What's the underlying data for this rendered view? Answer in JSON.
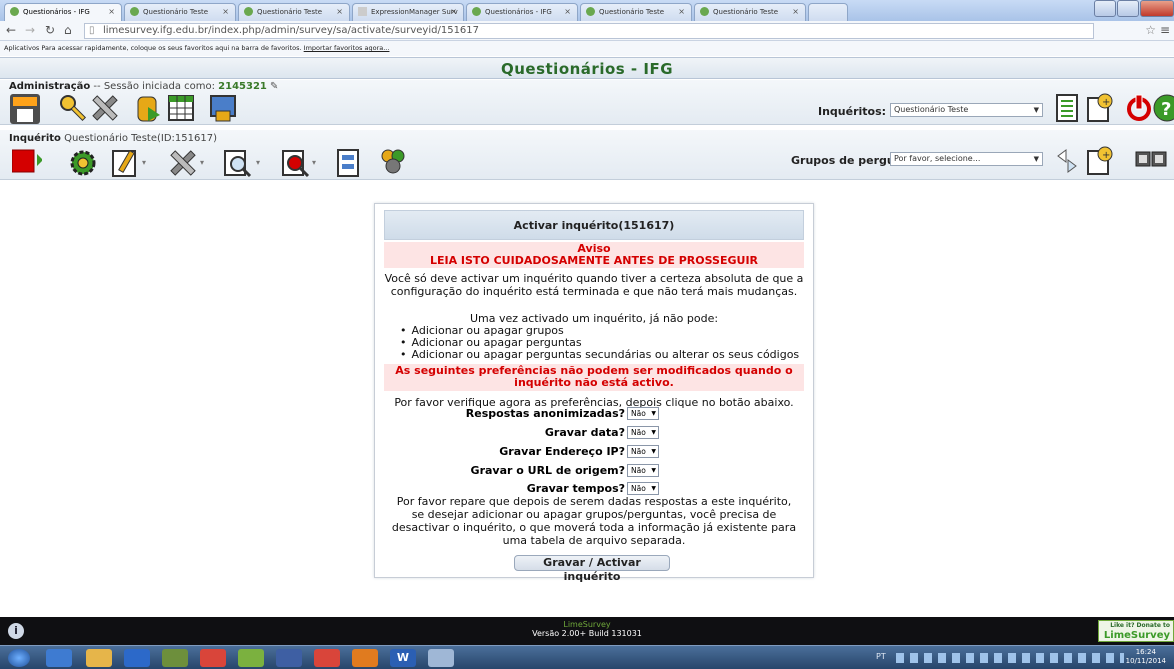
{
  "browser": {
    "tabs": [
      {
        "label": "Questionários - IFG",
        "active": true
      },
      {
        "label": "Questionário Teste",
        "active": false
      },
      {
        "label": "Questionário Teste",
        "active": false
      },
      {
        "label": "ExpressionManager Surv",
        "active": false
      },
      {
        "label": "Questionários - IFG",
        "active": false
      },
      {
        "label": "Questionário Teste",
        "active": false
      },
      {
        "label": "Questionário Teste",
        "active": false
      }
    ],
    "url": "limesurvey.ifg.edu.br/index.php/admin/survey/sa/activate/surveyid/151617",
    "bookmarks_bar": "Aplicativos   Para acessar rapidamente, coloque os seus favoritos aqui na barra de favoritos.",
    "bookmarks_link": "Importar favoritos agora..."
  },
  "app": {
    "title": "Questionários - IFG",
    "admin_label": "Administração",
    "session_text": " -- Sessão iniciada como: ",
    "session_user": "2145321",
    "surveys_label": "Inquéritos:",
    "surveys_selected": "Questionário Teste",
    "survey_label": "Inquérito",
    "survey_name": " Questionário Teste(ID:151617)",
    "groups_label": "Grupos de perguntas:",
    "groups_selected": "Por favor, selecione..."
  },
  "panel": {
    "heading": "Activar inquérito(151617)",
    "warning_title": "Aviso",
    "warning_sub": "LEIA ISTO CUIDADOSAMENTE ANTES DE PROSSEGUIR",
    "intro": "Você só deve activar um inquérito quando tiver a certeza absoluta de que a configuração do inquérito está terminada e que não terá mais mudanças.",
    "once_active": "Uma vez activado um inquérito, já não pode:",
    "bullets": [
      "Adicionar ou apagar grupos",
      "Adicionar ou apagar perguntas",
      "Adicionar ou apagar perguntas secundárias ou alterar os seus códigos"
    ],
    "prefs_warning": "As seguintes preferências não podem ser modificados quando o inquérito não está activo.",
    "check_prefs": "Por favor verifique agora as preferências, depois clique no botão abaixo.",
    "fields": [
      {
        "label": "Respostas anonimizadas?",
        "value": "Não"
      },
      {
        "label": "Gravar data?",
        "value": "Não"
      },
      {
        "label": "Gravar Endereço IP?",
        "value": "Não"
      },
      {
        "label": "Gravar o URL de origem?",
        "value": "Não"
      },
      {
        "label": "Gravar tempos?",
        "value": "Não"
      }
    ],
    "note": "Por favor repare que depois de serem dadas respostas a este inquérito, se desejar adicionar ou apagar grupos/perguntas, você precisa de desactivar o inquérito, o que moverá toda a informação já existente para uma tabela de arquivo separada.",
    "save_button": "Gravar / Activar inquérito"
  },
  "footer": {
    "brand": "LimeSurvey",
    "version": "Versão 2.00+ Build 131031",
    "donate": "Like it? Donate to",
    "donate_brand": "LimeSurvey"
  },
  "taskbar": {
    "time": "16:24",
    "date": "10/11/2014",
    "lang": "PT"
  }
}
